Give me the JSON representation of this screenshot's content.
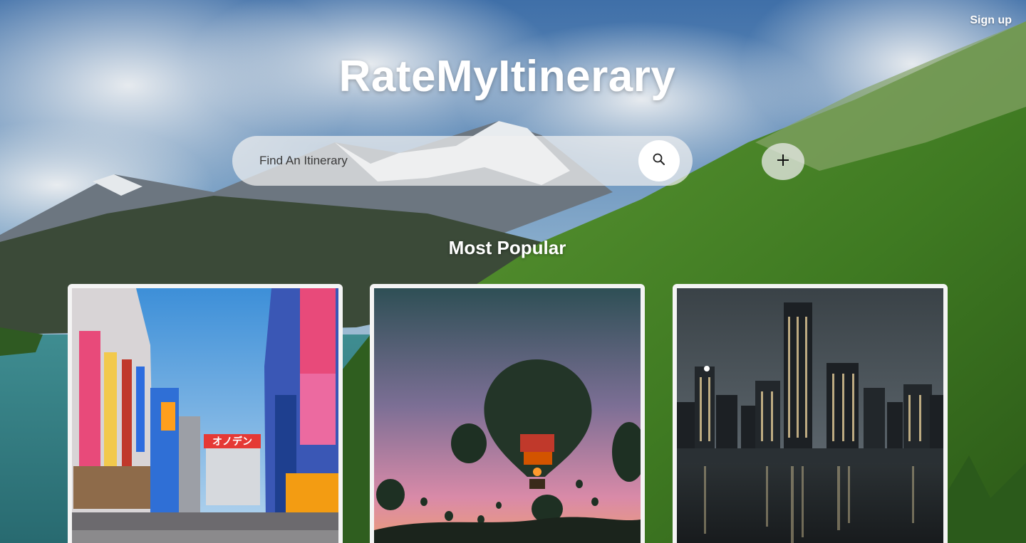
{
  "header": {
    "signup_label": "Sign up",
    "brand_title": "RateMyItinerary"
  },
  "search": {
    "placeholder": "Find An Itinerary",
    "value": "",
    "button_icon": "search-icon"
  },
  "add_button": {
    "icon": "plus-icon"
  },
  "popular": {
    "title": "Most Popular",
    "cards": [
      {
        "scene": "tokyo-akihabara-street",
        "sign_text": "オノデン"
      },
      {
        "scene": "hot-air-balloons-sunset"
      },
      {
        "scene": "night-city-skyline-waterfront"
      }
    ]
  },
  "colors": {
    "title_text": "#ffffff",
    "search_bar_bg": "#f0f0f0",
    "card_border": "#f4f4f4"
  }
}
